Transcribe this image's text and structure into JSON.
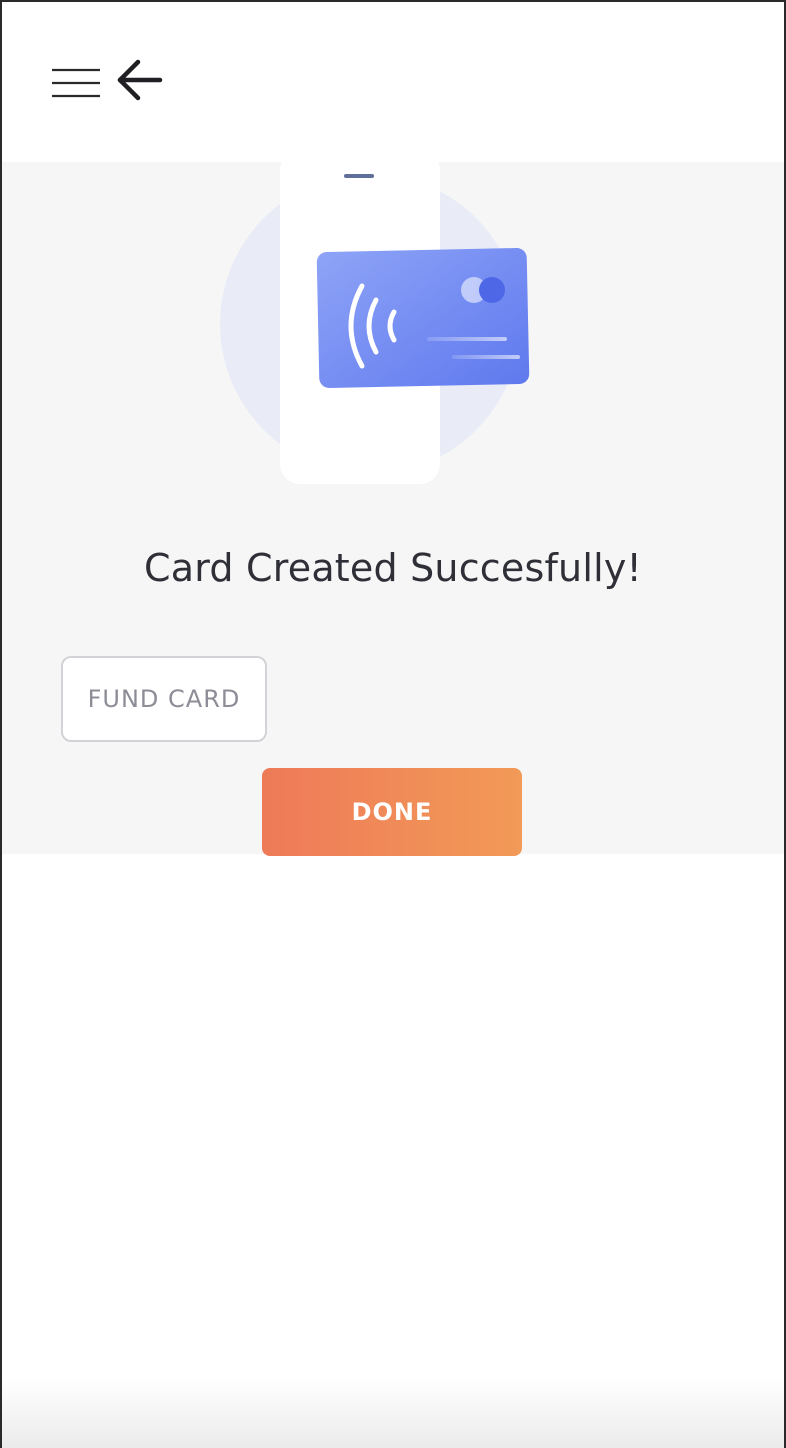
{
  "header": {
    "menu_icon": "hamburger-menu-icon",
    "back_icon": "arrow-left-icon"
  },
  "illustration": {
    "icons": [
      "phone-icon",
      "card-icon",
      "contactless-icon"
    ],
    "colors": {
      "circle": "#e9ecf7",
      "card_start": "#8ea4f7",
      "card_end": "#5f79ee"
    }
  },
  "main": {
    "title": "Card Created Succesfully!",
    "fund_card_label": "FUND CARD",
    "done_label": "DONE"
  },
  "colors": {
    "done_gradient_start": "#ee7a58",
    "done_gradient_end": "#f29a57",
    "content_background": "#f6f6f6"
  }
}
